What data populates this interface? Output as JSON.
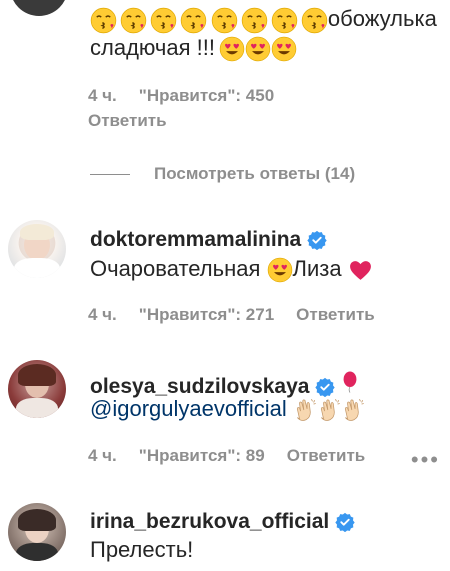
{
  "comment0": {
    "text_suffix": "обожулька",
    "text_line2": "сладючая !!!",
    "meta": {
      "time": "4 ч.",
      "likes": "\"Нравится\": 450",
      "reply": "Ответить"
    }
  },
  "view_replies": {
    "label": "Посмотреть ответы (14)"
  },
  "comment1": {
    "username": "doktoremmamalinina",
    "text_a": "Очаровательная",
    "text_b": "Лиза",
    "meta": {
      "time": "4 ч.",
      "likes": "\"Нравится\": 271",
      "reply": "Ответить"
    }
  },
  "comment2": {
    "username": "olesya_sudzilovskaya",
    "mention": "@igorgulyaevofficial",
    "meta": {
      "time": "4 ч.",
      "likes": "\"Нравится\": 89",
      "reply": "Ответить"
    },
    "more": "•••"
  },
  "comment3": {
    "username": "irina_bezrukova_official",
    "text": "Прелесть!"
  },
  "icons": {
    "verified": "verified-badge-icon",
    "kiss": "kissing-face-emoji",
    "heart_eyes": "heart-eyes-emoji",
    "heart": "red-heart-emoji",
    "balloon": "balloon-emoji",
    "clap": "clapping-hands-emoji",
    "more": "more-options-icon"
  },
  "colors": {
    "verified": "#3897f0",
    "meta": "#8e8e8e",
    "text": "#262626",
    "mention": "#003569"
  }
}
